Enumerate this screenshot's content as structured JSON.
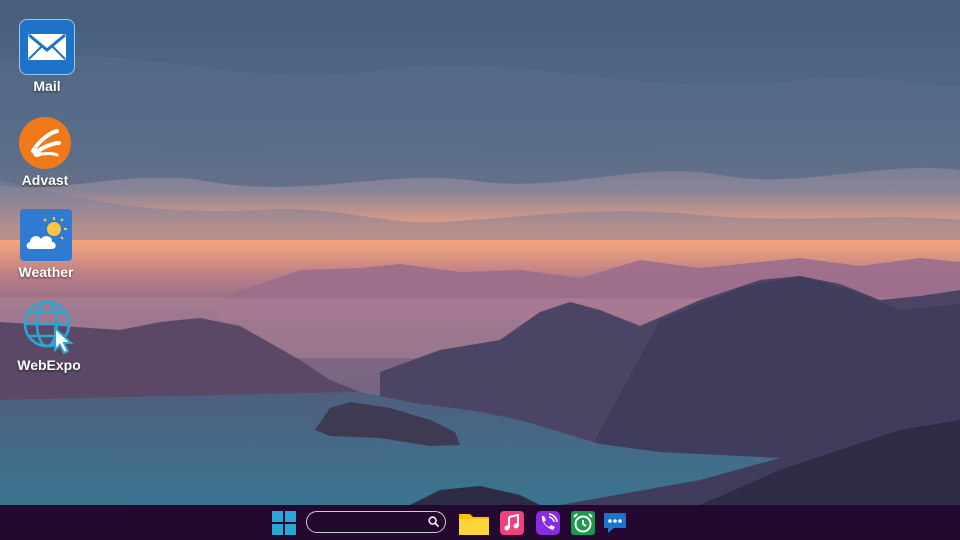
{
  "desktop": {
    "icons": [
      {
        "label": "Mail",
        "icon": "mail-icon",
        "color": "#1e73c8"
      },
      {
        "label": "Advast",
        "icon": "advast-icon",
        "color": "#f07a1a"
      },
      {
        "label": "Weather",
        "icon": "weather-icon",
        "color": "#2e7bd1"
      },
      {
        "label": "WebExpo",
        "icon": "globe-cursor-icon",
        "color": "#2aa6d6"
      }
    ]
  },
  "taskbar": {
    "background": "#23092f",
    "start_icon": "windows-start-icon",
    "search": {
      "placeholder": "",
      "value": "",
      "icon": "search-icon"
    },
    "apps": [
      {
        "name": "file-explorer",
        "icon": "folder-icon",
        "color": "#f6c200"
      },
      {
        "name": "music",
        "icon": "music-icon",
        "color": "#f0417a"
      },
      {
        "name": "phone",
        "icon": "phone-icon",
        "color": "#8a2be2"
      },
      {
        "name": "clock",
        "icon": "alarm-clock-icon",
        "color": "#1a9a4a"
      },
      {
        "name": "messages",
        "icon": "chat-icon",
        "color": "#1e73c8"
      }
    ]
  }
}
